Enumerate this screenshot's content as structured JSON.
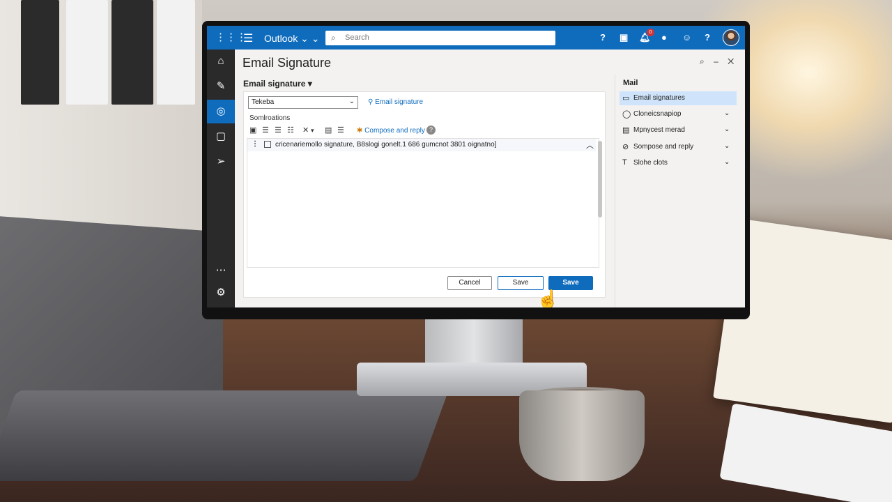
{
  "app": {
    "name": "Outlook"
  },
  "search": {
    "placeholder": "Search"
  },
  "notifications": {
    "count": "0"
  },
  "panel": {
    "title": "Email Signature"
  },
  "section": {
    "heading": "Email signature"
  },
  "signature_select": {
    "value": "Tekeba"
  },
  "links": {
    "email_signature": "Email signature",
    "compose_reply": "Compose and reply"
  },
  "editor": {
    "sublabel": "Somlroations",
    "row_text": "cricenariemollo signature, B8slogi gonelt.1 686 gumcnot 3801 oignatno]"
  },
  "buttons": {
    "cancel": "Cancel",
    "save_outline": "Save",
    "save_primary": "Save"
  },
  "right_pane": {
    "heading": "Mail",
    "items": [
      {
        "label": "Email signatures",
        "icon": "mail-icon",
        "active": true
      },
      {
        "label": "Cloneicsnapiop",
        "icon": "circle-icon"
      },
      {
        "label": "Mpnycest merad",
        "icon": "message-icon"
      },
      {
        "label": "Sompose and reply",
        "icon": "link-icon"
      },
      {
        "label": "Slohe clots",
        "icon": "text-icon"
      }
    ]
  },
  "colors": {
    "accent": "#0f6cbd",
    "rail": "#2a2a2a",
    "badge": "#d13438"
  }
}
